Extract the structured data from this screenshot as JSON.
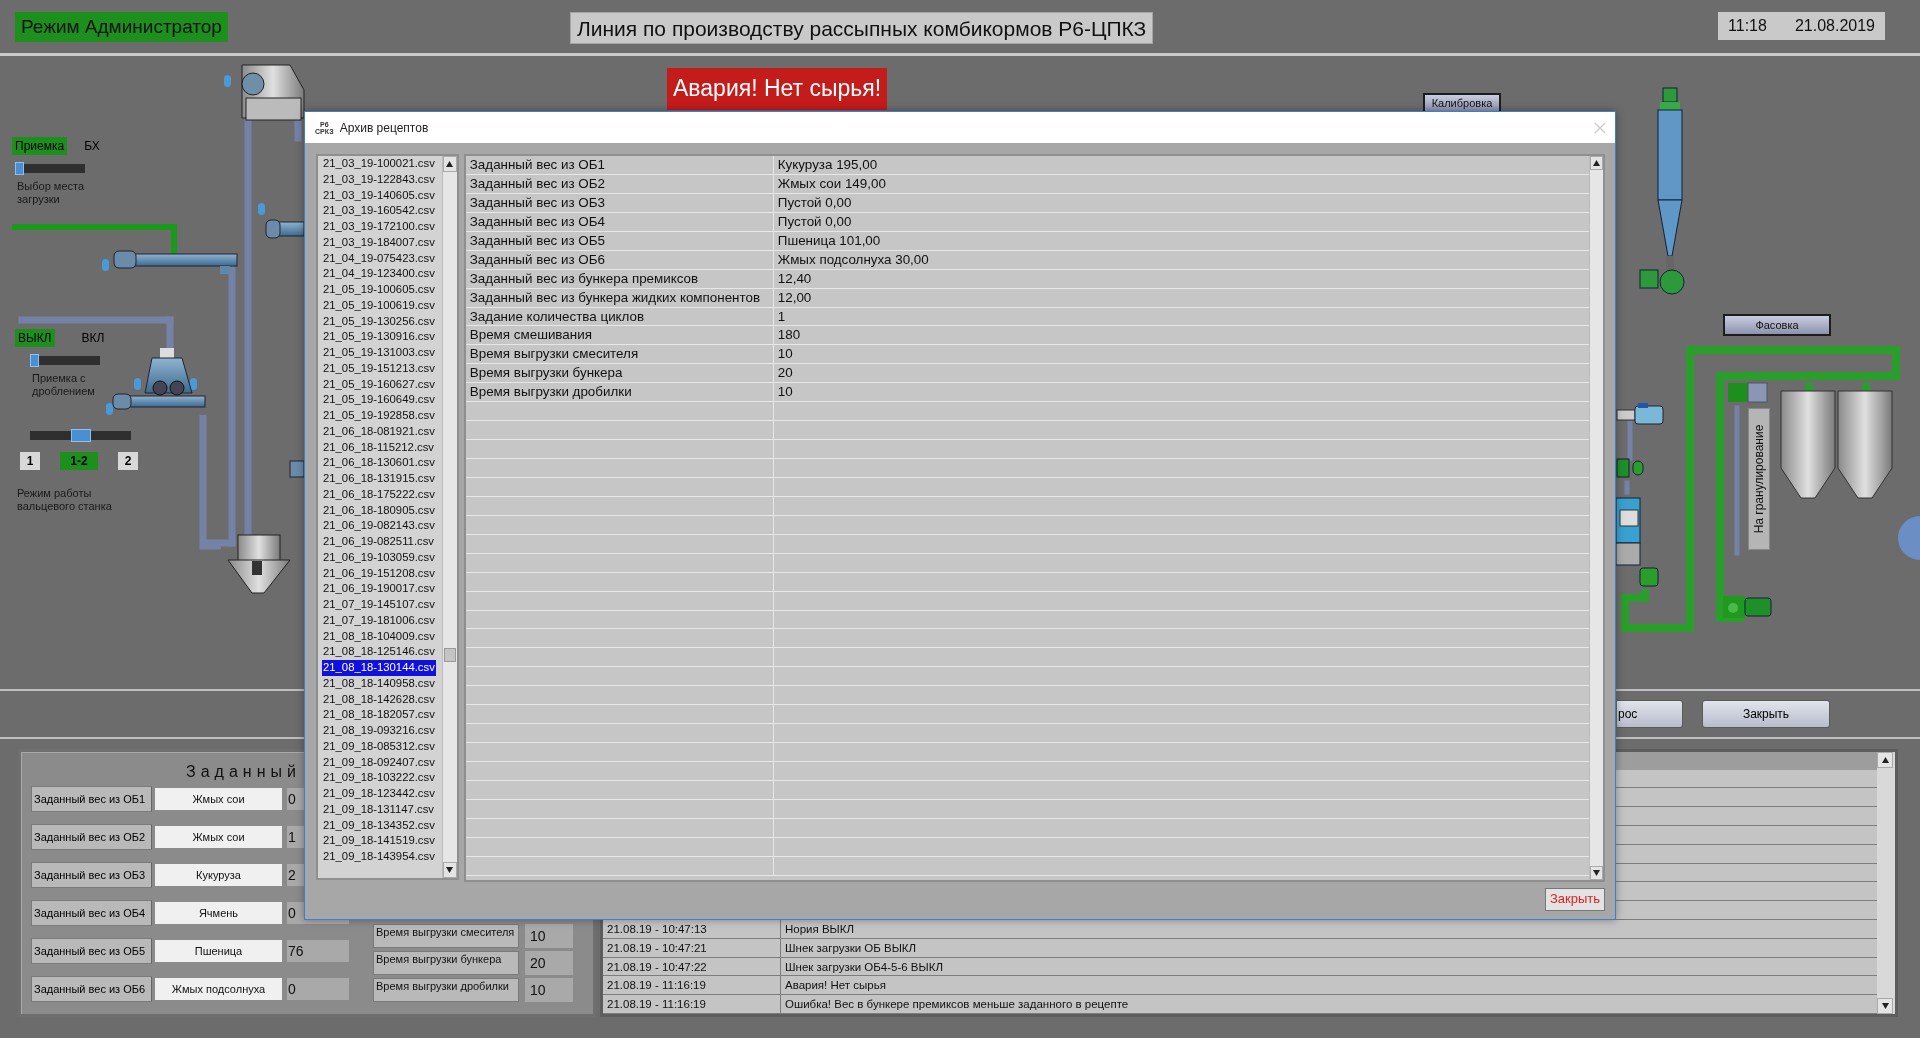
{
  "header": {
    "mode": "Режим Администратор",
    "title": "Линия по производству рассыпных комбикормов Р6-ЦПКЗ",
    "time": "11:18",
    "date": "21.08.2019"
  },
  "alarm_banner": "Авария! Нет сырья!",
  "calibration_button": "Калибровка",
  "packing_button": "Фасовка",
  "granulation_label": "На гранулирование",
  "mode_switches": [
    {
      "kind": "toggle",
      "options": [
        {
          "label": "Приемка",
          "selected": true
        },
        {
          "label": "БХ",
          "selected": false
        }
      ],
      "caption": "Выбор места загрузки"
    },
    {
      "kind": "toggle",
      "options": [
        {
          "label": "ВЫКЛ",
          "selected": true
        },
        {
          "label": "ВКЛ",
          "selected": false
        }
      ],
      "caption": "Приемка с дроблением"
    },
    {
      "kind": "three_position",
      "options": [
        {
          "label": "1",
          "selected": false
        },
        {
          "label": "1-2",
          "selected": true
        },
        {
          "label": "2",
          "selected": false
        }
      ],
      "caption": "Режим работы вальцевого станка"
    }
  ],
  "action_buttons": [
    "рос",
    "Закрыть"
  ],
  "setpoints": {
    "title": "Заданный",
    "rows": [
      {
        "label": "Заданный вес из ОБ1",
        "ingredient": "Жмых сои",
        "value": "0"
      },
      {
        "label": "Заданный вес из ОБ2",
        "ingredient": "Жмых сои",
        "value": "1"
      },
      {
        "label": "Заданный вес из ОБ3",
        "ingredient": "Кукуруза",
        "value": "2"
      },
      {
        "label": "Заданный вес из ОБ4",
        "ingredient": "Ячмень",
        "value": "0"
      },
      {
        "label": "Заданный вес из ОБ5",
        "ingredient": "Пшеница",
        "value": "76"
      },
      {
        "label": "Заданный вес из ОБ6",
        "ingredient": "Жмых подсолнуха",
        "value": "0"
      }
    ],
    "times": [
      {
        "label": "Время выгрузки смесителя",
        "value": "10"
      },
      {
        "label": "Время выгрузки бункера",
        "value": "20"
      },
      {
        "label": "Время выгрузки дробилки",
        "value": "10"
      }
    ]
  },
  "event_log": {
    "rows": [
      {
        "time": "21.08.19 - 10:47:13",
        "message": "Нория ВЫКЛ"
      },
      {
        "time": "21.08.19 - 10:47:21",
        "message": "Шнек загрузки ОБ ВЫКЛ"
      },
      {
        "time": "21.08.19 - 10:47:22",
        "message": "Шнек загрузки ОБ4-5-6 ВЫКЛ"
      },
      {
        "time": "21.08.19 - 11:16:19",
        "message": "Авария! Нет сырья"
      },
      {
        "time": "21.08.19 - 11:16:19",
        "message": "Ошибка! Вес в бункере премиксов меньше заданного в рецепте"
      }
    ]
  },
  "dialog": {
    "title": "Архив рецептов",
    "logo": [
      "Р6",
      "СРКЗ"
    ],
    "files": [
      {
        "name": "21_03_19-100021.csv",
        "selected": false
      },
      {
        "name": "21_03_19-122843.csv",
        "selected": false
      },
      {
        "name": "21_03_19-140605.csv",
        "selected": false
      },
      {
        "name": "21_03_19-160542.csv",
        "selected": false
      },
      {
        "name": "21_03_19-172100.csv",
        "selected": false
      },
      {
        "name": "21_03_19-184007.csv",
        "selected": false
      },
      {
        "name": "21_04_19-075423.csv",
        "selected": false
      },
      {
        "name": "21_04_19-123400.csv",
        "selected": false
      },
      {
        "name": "21_05_19-100605.csv",
        "selected": false
      },
      {
        "name": "21_05_19-100619.csv",
        "selected": false
      },
      {
        "name": "21_05_19-130256.csv",
        "selected": false
      },
      {
        "name": "21_05_19-130916.csv",
        "selected": false
      },
      {
        "name": "21_05_19-131003.csv",
        "selected": false
      },
      {
        "name": "21_05_19-151213.csv",
        "selected": false
      },
      {
        "name": "21_05_19-160627.csv",
        "selected": false
      },
      {
        "name": "21_05_19-160649.csv",
        "selected": false
      },
      {
        "name": "21_05_19-192858.csv",
        "selected": false
      },
      {
        "name": "21_06_18-081921.csv",
        "selected": false
      },
      {
        "name": "21_06_18-115212.csv",
        "selected": false
      },
      {
        "name": "21_06_18-130601.csv",
        "selected": false
      },
      {
        "name": "21_06_18-131915.csv",
        "selected": false
      },
      {
        "name": "21_06_18-175222.csv",
        "selected": false
      },
      {
        "name": "21_06_18-180905.csv",
        "selected": false
      },
      {
        "name": "21_06_19-082143.csv",
        "selected": false
      },
      {
        "name": "21_06_19-082511.csv",
        "selected": false
      },
      {
        "name": "21_06_19-103059.csv",
        "selected": false
      },
      {
        "name": "21_06_19-151208.csv",
        "selected": false
      },
      {
        "name": "21_06_19-190017.csv",
        "selected": false
      },
      {
        "name": "21_07_19-145107.csv",
        "selected": false
      },
      {
        "name": "21_07_19-181006.csv",
        "selected": false
      },
      {
        "name": "21_08_18-104009.csv",
        "selected": false
      },
      {
        "name": "21_08_18-125146.csv",
        "selected": false
      },
      {
        "name": "21_08_18-130144.csv",
        "selected": true
      },
      {
        "name": "21_08_18-140958.csv",
        "selected": false
      },
      {
        "name": "21_08_18-142628.csv",
        "selected": false
      },
      {
        "name": "21_08_18-182057.csv",
        "selected": false
      },
      {
        "name": "21_08_19-093216.csv",
        "selected": false
      },
      {
        "name": "21_09_18-085312.csv",
        "selected": false
      },
      {
        "name": "21_09_18-092407.csv",
        "selected": false
      },
      {
        "name": "21_09_18-103222.csv",
        "selected": false
      },
      {
        "name": "21_09_18-123442.csv",
        "selected": false
      },
      {
        "name": "21_09_18-131147.csv",
        "selected": false
      },
      {
        "name": "21_09_18-134352.csv",
        "selected": false
      },
      {
        "name": "21_09_18-141519.csv",
        "selected": false
      },
      {
        "name": "21_09_18-143954.csv",
        "selected": false
      }
    ],
    "recipe": [
      {
        "parameter": "Заданный вес из ОБ1",
        "value": "Кукуруза 195,00"
      },
      {
        "parameter": "Заданный вес из ОБ2",
        "value": "Жмых сои 149,00"
      },
      {
        "parameter": "Заданный вес из ОБ3",
        "value": "Пустой 0,00"
      },
      {
        "parameter": "Заданный вес из ОБ4",
        "value": "Пустой 0,00"
      },
      {
        "parameter": "Заданный вес из ОБ5",
        "value": "Пшеница 101,00"
      },
      {
        "parameter": "Заданный вес из ОБ6",
        "value": "Жмых подсолнуха 30,00"
      },
      {
        "parameter": "Заданный вес из бункера премиксов",
        "value": "12,40"
      },
      {
        "parameter": "Заданный вес из бункера жидких компонентов",
        "value": "12,00"
      },
      {
        "parameter": "Задание количества циклов",
        "value": "1"
      },
      {
        "parameter": "Время смешивания",
        "value": "180"
      },
      {
        "parameter": "Время выгрузки смесителя",
        "value": "10"
      },
      {
        "parameter": "Время выгрузки бункера",
        "value": "20"
      },
      {
        "parameter": "Время выгрузки дробилки",
        "value": "10"
      }
    ],
    "close_button": "Закрыть"
  }
}
